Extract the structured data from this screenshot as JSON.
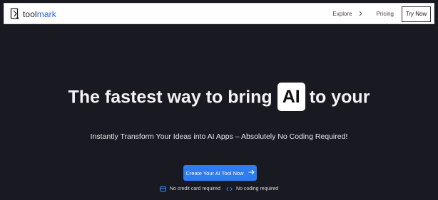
{
  "brand": {
    "name_prefix": "tool",
    "name_suffix": "mark",
    "accent_color": "#2563eb"
  },
  "nav": {
    "explore_label": "Explore",
    "pricing_label": "Pricing",
    "try_label": "Try Now"
  },
  "hero": {
    "headline_before": "The fastest way to bring",
    "headline_chip": "AI",
    "headline_after": "to your",
    "subheadline": "Instantly Transform Your Ideas into AI Apps – Absolutely No Coding Required!",
    "cta_label": "Create Your AI Tool Now",
    "cta_color": "#2f7bf0"
  },
  "badges": [
    {
      "icon": "credit-card-icon",
      "label": "No credit card required"
    },
    {
      "icon": "code-icon",
      "label": "No coding required"
    }
  ]
}
